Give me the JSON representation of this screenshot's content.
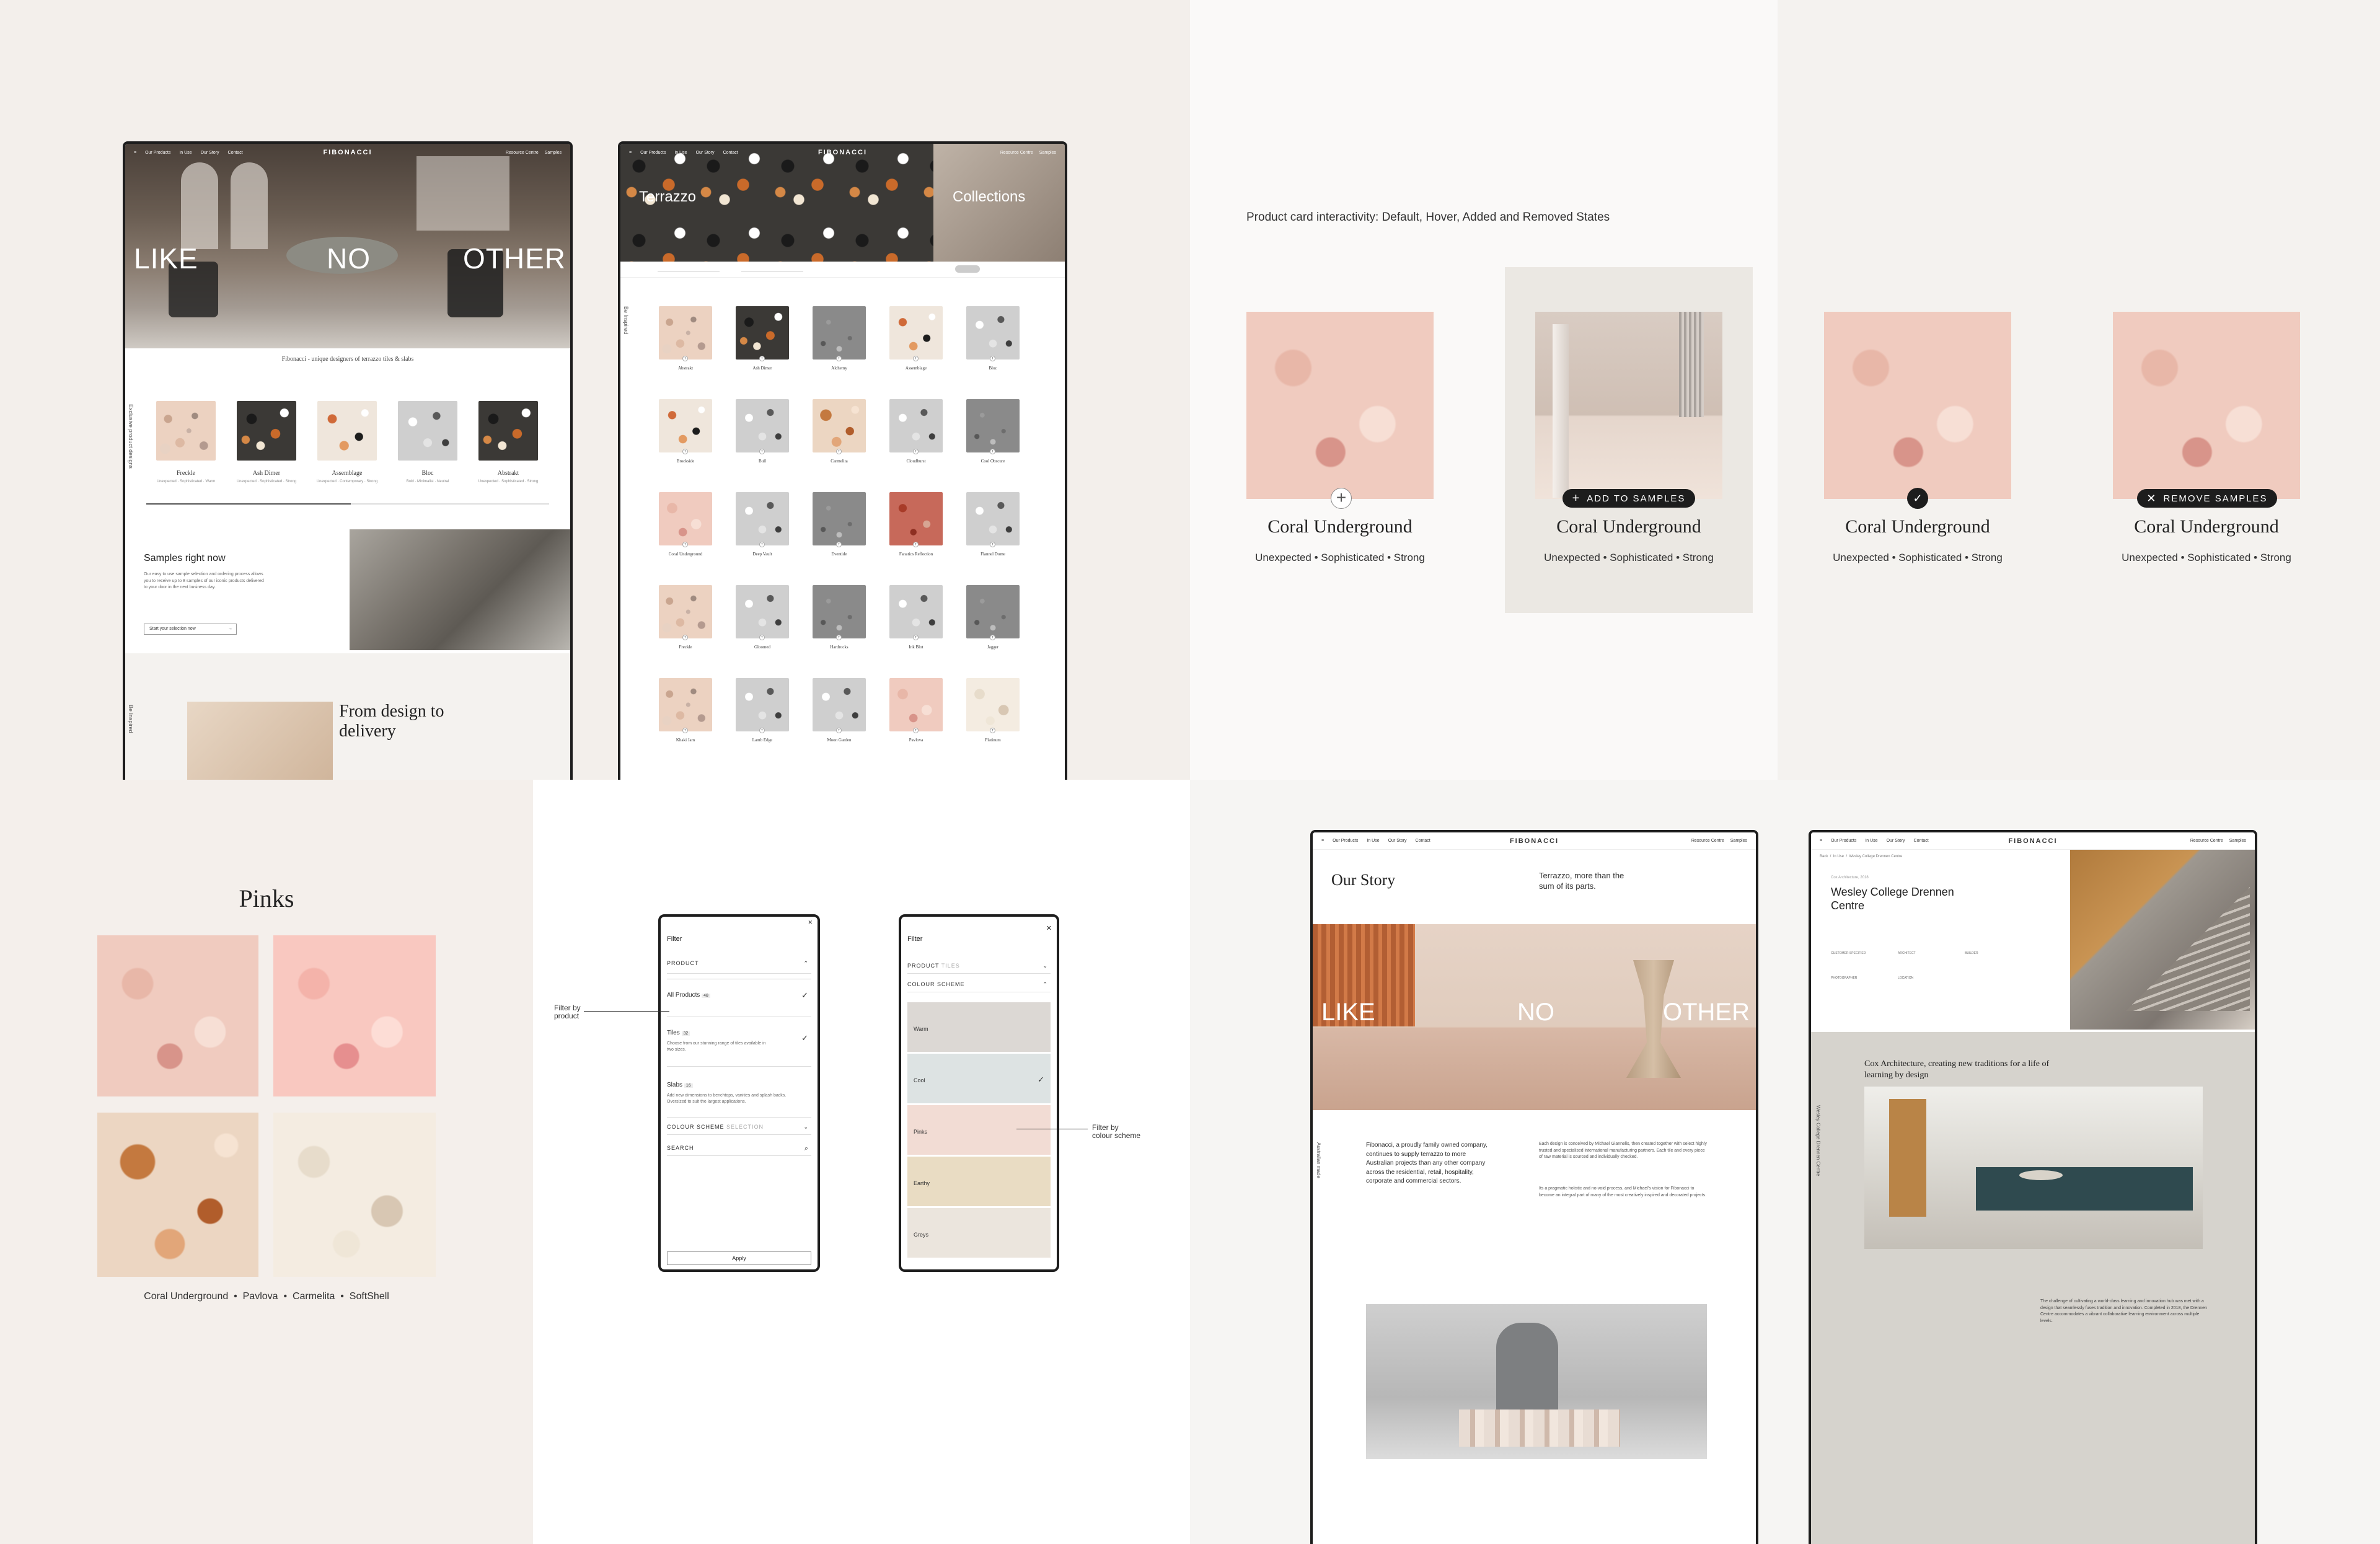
{
  "q1": {
    "home": {
      "nav_left": [
        "Our Products",
        "In Use",
        "Our Story",
        "Contact"
      ],
      "logo": "FIBONACCI",
      "nav_right": [
        "Resource Centre",
        "Samples"
      ],
      "hero_words": [
        "LIKE",
        "NO",
        "OTHER"
      ],
      "tagline": "Fibonacci - unique designers of terrazzo tiles & slabs",
      "side_label": "Exclusive product designs",
      "products": [
        {
          "name": "Freckle",
          "tags": "Unexpected · Sophisticated · Warm"
        },
        {
          "name": "Ash Dimer",
          "tags": "Unexpected · Sophisticated · Strong"
        },
        {
          "name": "Assemblage",
          "tags": "Unexpected · Contemporary · Strong"
        },
        {
          "name": "Bloc",
          "tags": "Bold · Minimalist · Neutral"
        },
        {
          "name": "Abstrakt",
          "tags": "Unexpected · Sophisticated · Strong"
        }
      ],
      "samples_title": "Samples right now",
      "samples_body": "Our easy to use sample selection and ordering process allows you to receive up to 8 samples of our iconic products delivered to your door in the next business day.",
      "samples_button": "Start your selection now",
      "side_label2": "Be Inspired",
      "design_title": "From design to delivery"
    },
    "listing": {
      "nav_left": [
        "Our Products",
        "In Use",
        "Our Story",
        "Contact"
      ],
      "logo": "FIBONACCI",
      "nav_right": [
        "Resource Centre",
        "Samples"
      ],
      "banner_left": "Terrazzo",
      "banner_right": "Collections",
      "side_label": "Be Inspired",
      "grid": [
        [
          "Abstrakt",
          "Ash Dimer",
          "Alchemy",
          "Assemblage",
          "Bloc"
        ],
        [
          "Brockside",
          "Bull",
          "Carmelita",
          "Cloudburst",
          "Cool Obscure"
        ],
        [
          "Coral Underground",
          "Deep Vault",
          "Eventide",
          "Fanatics Reflection",
          "Flannel Dome"
        ],
        [
          "Freckle",
          "Gloomed",
          "Hardrocks",
          "Ink Blot",
          "Jagger"
        ],
        [
          "Khaki Jam",
          "Lamb Edge",
          "Moon Garden",
          "Pavlova",
          "Platinum"
        ]
      ]
    }
  },
  "q2": {
    "caption": "Product card interactivity: Default, Hover, Added and Removed States",
    "cards": [
      {
        "name": "Coral Underground",
        "tags": "Unexpected • Sophisticated • Strong",
        "action": ""
      },
      {
        "name": "Coral Underground",
        "tags": "Unexpected • Sophisticated • Strong",
        "action": "ADD TO SAMPLES"
      },
      {
        "name": "Coral Underground",
        "tags": "Unexpected • Sophisticated • Strong",
        "action": ""
      },
      {
        "name": "Coral Underground",
        "tags": "Unexpected • Sophisticated • Strong",
        "action": "REMOVE SAMPLES"
      }
    ]
  },
  "q3": {
    "pinks_title": "Pinks",
    "pinks_caption": "Coral Underground  •  Pavlova  •  Carmelita  •  SoftShell",
    "filter1": {
      "title": "Filter",
      "product_label": "PRODUCT",
      "options": [
        {
          "name": "All Products",
          "count": "48",
          "desc": ""
        },
        {
          "name": "Tiles",
          "count": "32",
          "desc": "Choose from our stunning range of tiles available in two sizes."
        },
        {
          "name": "Slabs",
          "count": "16",
          "desc": "Add new dimensions to benchtops, vanities and splash backs. Oversized to suit the largest applications."
        }
      ],
      "colour_label": "COLOUR SCHEME",
      "colour_hint": "SELECTION",
      "search_label": "SEARCH",
      "apply": "Apply"
    },
    "filter2": {
      "title": "Filter",
      "product_label": "PRODUCT",
      "product_hint": "TILES",
      "colour_label": "COLOUR SCHEME",
      "swatches": [
        {
          "name": "Warm",
          "color": "#dcd8d4"
        },
        {
          "name": "Cool",
          "color": "#dde3e3"
        },
        {
          "name": "Pinks",
          "color": "#f2dcd4"
        },
        {
          "name": "Earthy",
          "color": "#e9dcc3"
        },
        {
          "name": "Greys",
          "color": "#ebe5dd"
        }
      ]
    },
    "annot1": "Filter by\nproduct",
    "annot2": "Filter by\ncolour scheme"
  },
  "q4": {
    "story": {
      "nav_left": [
        "Our Products",
        "In Use",
        "Our Story",
        "Contact"
      ],
      "logo": "FIBONACCI",
      "nav_right": [
        "Resource Centre",
        "Samples"
      ],
      "title": "Our Story",
      "subtitle": "Terrazzo, more than the sum of its parts.",
      "hero_words": [
        "LIKE",
        "NO",
        "OTHER"
      ],
      "side_label": "Australian made",
      "intro": "Fibonacci, a proudly family owned company, continues to supply terrazzo to more Australian projects than any other company across the residential, retail, hospitality, corporate and commercial sectors.",
      "body": "Each design is conceived by Michael Giannelis, then created together with select highly trusted and specialised international manufacturing partners. Each tile and every piece of raw material is sourced and individually checked.",
      "body2": "Its a pragmatic holistic and no-void process, and Michael's vision for Fibonacci to become an integral part of many of the most creatively inspired and decorated projects."
    },
    "project": {
      "nav_left": [
        "Our Products",
        "In Use",
        "Our Story",
        "Contact"
      ],
      "logo": "FIBONACCI",
      "nav_right": [
        "Resource Centre",
        "Samples"
      ],
      "breadcrumb": "Back  /  In Use  /  Wesley College Drennen Centre",
      "eyebrow": "Cox Architecture, 2018",
      "title": "Wesley College Drennen Centre",
      "meta_labels": [
        "CUSTOMER SPECIFIED",
        "ARCHITECT",
        "BUILDER",
        "PHOTOGRAPHER",
        "LOCATION"
      ],
      "quote": "Cox Architecture, creating new traditions for a life of learning by design",
      "side_label": "Wesley College Drennen Centre",
      "body": "The challenge of cultivating a world-class learning and innovation hub was met with a design that seamlessly fuses tradition and innovation. Completed in 2018, the Drennen Centre accommodates a vibrant collaborative learning environment across multiple levels."
    }
  },
  "colors": {
    "bg_left": "#f3efeb",
    "bg_right": "#f6f5f3",
    "pill": "#1d1d1d",
    "card_hover_bg": "#ebe8e3"
  }
}
